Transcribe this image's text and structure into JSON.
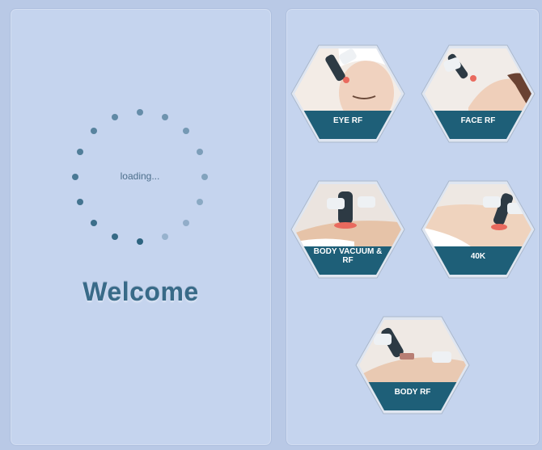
{
  "splash": {
    "loading_text": "loading...",
    "welcome_text": "Welcome"
  },
  "menu": {
    "tiles": [
      {
        "label": "EYE RF",
        "icon": "eye-rf-icon"
      },
      {
        "label": "FACE RF",
        "icon": "face-rf-icon"
      },
      {
        "label": "BODY VACUUM & RF",
        "icon": "body-vacuum-rf-icon"
      },
      {
        "label": "40K",
        "icon": "40k-icon"
      },
      {
        "label": "BODY RF",
        "icon": "body-rf-icon"
      }
    ]
  },
  "colors": {
    "background": "#b9c9e6",
    "panel": "#c5d4ee",
    "accent": "#1e5f78",
    "welcome": "#386a88"
  }
}
